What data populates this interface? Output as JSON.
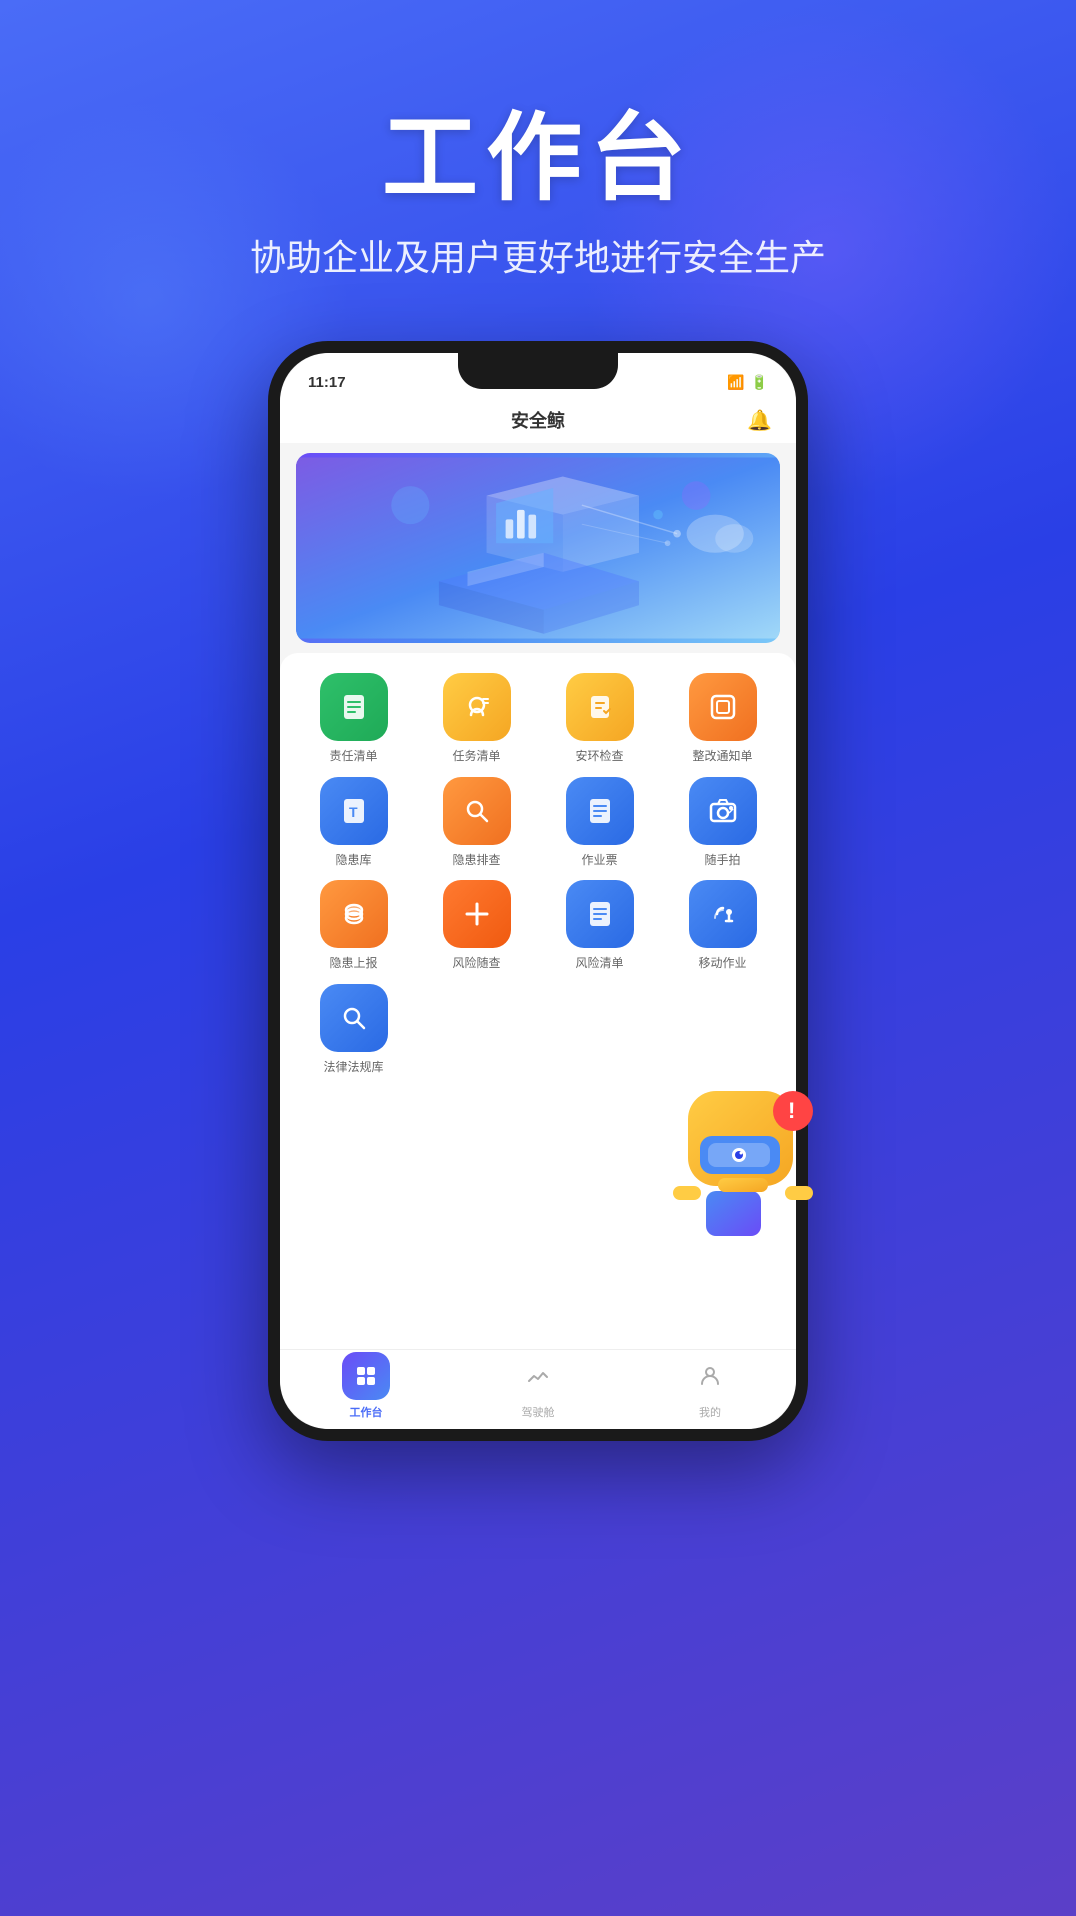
{
  "header": {
    "title": "工作台",
    "subtitle": "协助企业及用户更好地进行安全生产"
  },
  "phone": {
    "status_bar": {
      "time": "11:17",
      "icons": "▲▲🔋"
    },
    "app_name": "安全鲸",
    "banner_alt": "安全生产数字化平台展示图"
  },
  "menu": {
    "row1": [
      {
        "id": "duty-list",
        "label": "责任清单",
        "icon": "📋",
        "color": "green"
      },
      {
        "id": "task-list",
        "label": "任务清单",
        "icon": "👤",
        "color": "yellow"
      },
      {
        "id": "safety-check",
        "label": "安环检查",
        "icon": "✏️",
        "color": "yellow"
      },
      {
        "id": "rectify-notice",
        "label": "整改通知单",
        "icon": "📱",
        "color": "orange"
      }
    ],
    "row2": [
      {
        "id": "hazard-lib",
        "label": "隐患库",
        "icon": "🗒",
        "color": "blue"
      },
      {
        "id": "hazard-check",
        "label": "隐患排查",
        "icon": "🔍",
        "color": "orange"
      },
      {
        "id": "work-ticket",
        "label": "作业票",
        "icon": "📋",
        "color": "blue"
      },
      {
        "id": "quick-photo",
        "label": "随手拍",
        "icon": "📷",
        "color": "blue"
      }
    ],
    "row3": [
      {
        "id": "hazard-upload",
        "label": "隐患上报",
        "icon": "💾",
        "color": "orange"
      },
      {
        "id": "risk-check",
        "label": "风险随查",
        "icon": "➕",
        "color": "orange2"
      },
      {
        "id": "risk-list",
        "label": "风险清单",
        "icon": "📋",
        "color": "blue"
      },
      {
        "id": "mobile-work",
        "label": "移动作业",
        "icon": "🔗",
        "color": "blue"
      }
    ],
    "row4": [
      {
        "id": "law-lib",
        "label": "法律法规库",
        "icon": "🔍",
        "color": "blue"
      }
    ]
  },
  "bottom_nav": [
    {
      "id": "workbench",
      "label": "工作台",
      "active": true,
      "icon": "⊞"
    },
    {
      "id": "dashboard",
      "label": "驾驶舱",
      "active": false,
      "icon": "📈"
    },
    {
      "id": "profile",
      "label": "我的",
      "active": false,
      "icon": "👤"
    }
  ],
  "mascot": {
    "alt": "安全机器人吉祥物",
    "symbol": "!"
  }
}
